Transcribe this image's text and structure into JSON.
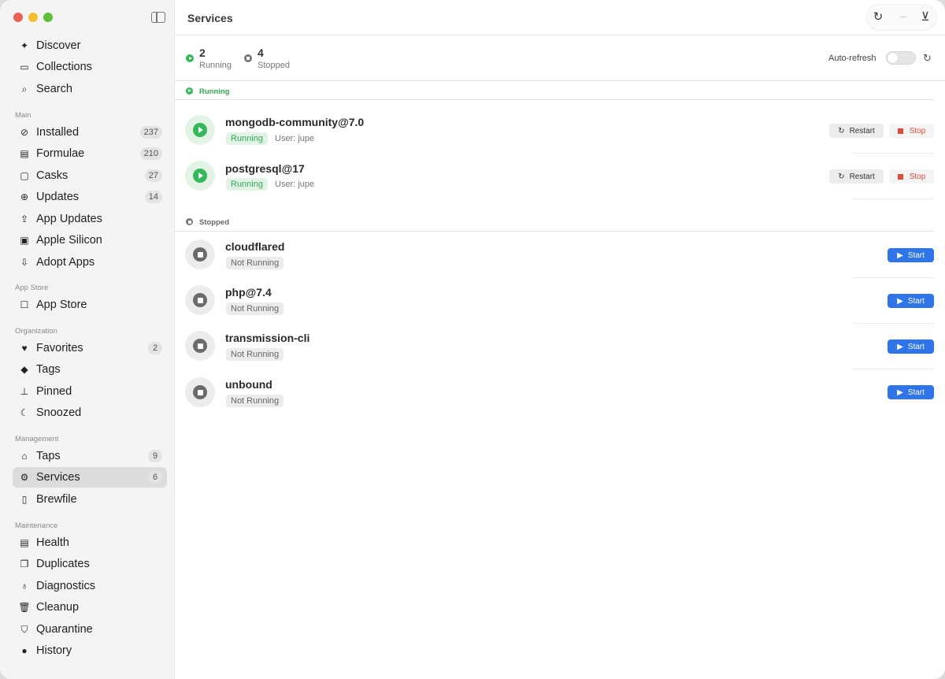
{
  "window": {
    "title": "Services"
  },
  "toolbar": {
    "refresh_icon": "refresh-icon",
    "download_icon": "download-icon"
  },
  "sidebar": {
    "top": [
      {
        "label": "Discover",
        "icon": "sparkle-icon"
      },
      {
        "label": "Collections",
        "icon": "collections-icon"
      },
      {
        "label": "Search",
        "icon": "search-icon"
      }
    ],
    "sections": [
      {
        "title": "Main",
        "items": [
          {
            "label": "Installed",
            "badge": "237",
            "icon": "check-circle-icon"
          },
          {
            "label": "Formulae",
            "badge": "210",
            "icon": "terminal-icon"
          },
          {
            "label": "Casks",
            "badge": "27",
            "icon": "cask-icon"
          },
          {
            "label": "Updates",
            "badge": "14",
            "icon": "arrow-up-circle-icon"
          },
          {
            "label": "App Updates",
            "icon": "app-updates-icon"
          },
          {
            "label": "Apple Silicon",
            "icon": "chip-icon"
          },
          {
            "label": "Adopt Apps",
            "icon": "adopt-icon"
          }
        ]
      },
      {
        "title": "App Store",
        "items": [
          {
            "label": "App Store",
            "icon": "app-store-icon"
          }
        ]
      },
      {
        "title": "Organization",
        "items": [
          {
            "label": "Favorites",
            "badge": "2",
            "icon": "heart-icon"
          },
          {
            "label": "Tags",
            "icon": "tag-icon"
          },
          {
            "label": "Pinned",
            "icon": "pin-icon"
          },
          {
            "label": "Snoozed",
            "icon": "snooze-icon"
          }
        ]
      },
      {
        "title": "Management",
        "items": [
          {
            "label": "Taps",
            "badge": "9",
            "icon": "taps-icon"
          },
          {
            "label": "Services",
            "badge": "6",
            "icon": "gears-icon"
          },
          {
            "label": "Brewfile",
            "icon": "document-icon"
          }
        ]
      },
      {
        "title": "Maintenance",
        "items": [
          {
            "label": "Health",
            "icon": "health-icon"
          },
          {
            "label": "Duplicates",
            "icon": "duplicates-icon"
          },
          {
            "label": "Diagnostics",
            "icon": "stethoscope-icon"
          },
          {
            "label": "Cleanup",
            "icon": "trash-icon"
          },
          {
            "label": "Quarantine",
            "icon": "shield-icon"
          },
          {
            "label": "History",
            "icon": "clock-icon"
          }
        ]
      }
    ],
    "selected": "Services"
  },
  "summary": {
    "running_count": "2",
    "running_label": "Running",
    "stopped_count": "4",
    "stopped_label": "Stopped",
    "auto_refresh_label": "Auto-refresh",
    "auto_refresh_on": false
  },
  "groups": [
    {
      "title": "Running",
      "status": "running",
      "services": [
        {
          "name": "mongodb-community@7.0",
          "status": "Running",
          "user": "User: jupe",
          "actions": [
            "Restart",
            "Stop"
          ]
        },
        {
          "name": "postgresql@17",
          "status": "Running",
          "user": "User: jupe",
          "actions": [
            "Restart",
            "Stop"
          ]
        }
      ]
    },
    {
      "title": "Stopped",
      "status": "stopped",
      "services": [
        {
          "name": "cloudflared",
          "status": "Not Running",
          "actions": [
            "Start"
          ]
        },
        {
          "name": "php@7.4",
          "status": "Not Running",
          "actions": [
            "Start"
          ]
        },
        {
          "name": "transmission-cli",
          "status": "Not Running",
          "actions": [
            "Start"
          ]
        },
        {
          "name": "unbound",
          "status": "Not Running",
          "actions": [
            "Start"
          ]
        }
      ]
    }
  ],
  "colors": {
    "accent": "#2f74e8",
    "running": "#34b85a",
    "stop": "#e04c3c",
    "selected_bg": "#dcdcdc"
  }
}
